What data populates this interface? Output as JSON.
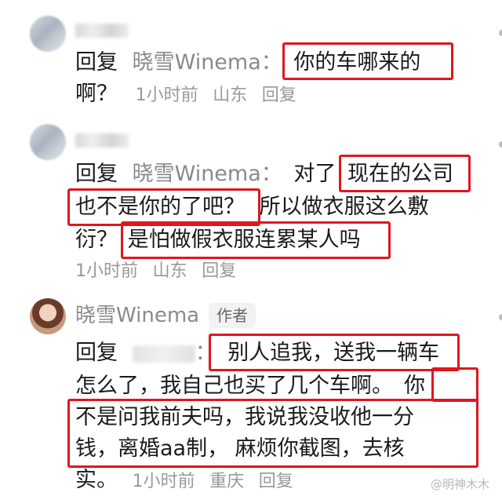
{
  "comments": [
    {
      "lines": [
        {
          "prefix": "回复",
          "user": "晓雪Winema",
          "sep": "：",
          "text": "你的车哪来的"
        },
        {
          "text": "啊？"
        }
      ],
      "meta": {
        "time": "1小时前",
        "location": "山东",
        "reply": "回复"
      }
    },
    {
      "lines": [
        {
          "prefix": "回复",
          "user": "晓雪Winema",
          "sep": "：",
          "text_a": "对了",
          "text_b": "现在的公司"
        },
        {
          "text_a": "也不是你的了吧？",
          "text_b": "所以做衣服这么敷"
        },
        {
          "text_a": "衍？",
          "text_b": "是怕做假衣服连累某人吗"
        }
      ],
      "meta": {
        "time": "1小时前",
        "location": "山东",
        "reply": "回复"
      }
    },
    {
      "author": {
        "name": "晓雪Winema",
        "tag": "作者"
      },
      "lines": [
        {
          "prefix": "回复",
          "sep": "：",
          "text": "别人追我，送我一辆车"
        },
        {
          "text_a": "怎么了，我自己也买了几个车啊。",
          "text_b": "你"
        },
        {
          "text": "不是问我前夫吗，我说我没收他一分"
        },
        {
          "text": "钱，离婚aa制， 麻烦你截图，去核"
        },
        {
          "text": "实。"
        }
      ],
      "meta": {
        "time": "1小时前",
        "location": "重庆",
        "reply": "回复"
      }
    }
  ],
  "watermark": "@明神木木"
}
